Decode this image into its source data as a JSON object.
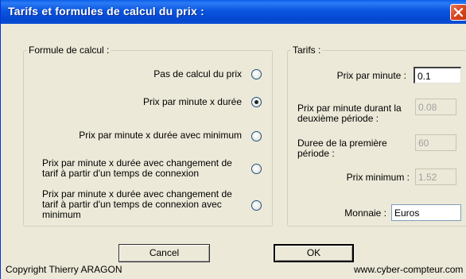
{
  "window": {
    "title": "Tarifs et formules de calcul du prix :"
  },
  "formule": {
    "group_label": "Formule de calcul :",
    "options": [
      {
        "label": "Pas de calcul du prix",
        "selected": false
      },
      {
        "label": "Prix par minute x durée",
        "selected": true
      },
      {
        "label": "Prix par minute x durée avec minimum",
        "selected": false
      },
      {
        "label": "Prix par minute x durée avec changement de tarif à partir d'un temps de connexion",
        "selected": false
      },
      {
        "label": "Prix par minute x durée avec changement de tarif à partir d'un temps de connexion avec minimum",
        "selected": false
      }
    ]
  },
  "tarifs": {
    "group_label": "Tarifs :",
    "prix_minute_label": "Prix par minute :",
    "prix_minute_value": "0.1",
    "prix_deuxieme_label": "Prix par minute durant la deuxième période :",
    "prix_deuxieme_value": "0.08",
    "duree_label": "Duree de la première période :",
    "duree_value": "60",
    "prix_minimum_label": "Prix minimum :",
    "prix_minimum_value": "1.52",
    "monnaie_label": "Monnaie :",
    "monnaie_value": "Euros"
  },
  "buttons": {
    "cancel": "Cancel",
    "ok": "OK"
  },
  "footer": {
    "copyright": "Copyright Thierry ARAGON",
    "website": "www.cyber-compteur.com"
  },
  "colors": {
    "title_bar": "#0a56e0",
    "close_button": "#d9481f",
    "radio_selected": "#21a121",
    "background": "#ece9d8"
  }
}
